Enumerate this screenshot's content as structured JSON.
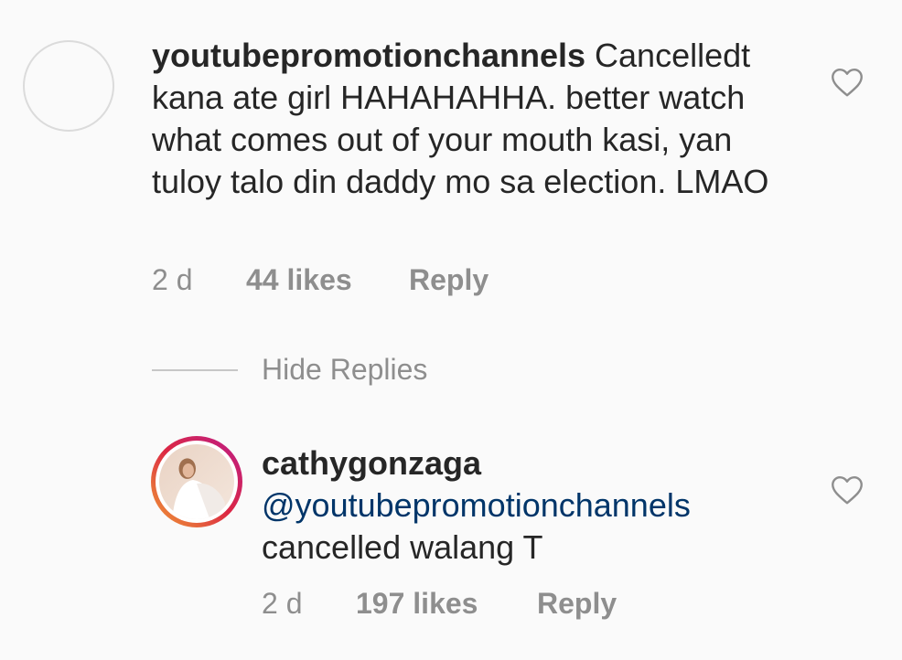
{
  "comments": [
    {
      "username": "youtubepromotionchannels",
      "text": "Cancelledt kana ate girl HAHAHAHHA. better watch what comes out of your mouth kasi, yan tuloy talo din daddy mo sa election. LMAO",
      "time": "2 d",
      "likes": "44 likes",
      "reply_label": "Reply",
      "avatar_icon": "default-avatar",
      "liked": false
    },
    {
      "username": "cathygonzaga",
      "mention": "@youtubepromotionchannels",
      "text": "cancelled walang T",
      "time": "2 d",
      "likes": "197 likes",
      "reply_label": "Reply",
      "avatar_icon": "profile-photo-with-story-ring",
      "liked": false
    }
  ],
  "thread": {
    "hide_replies_label": "Hide Replies"
  },
  "colors": {
    "text": "#262626",
    "secondary": "#8e8e8e",
    "mention": "#003569",
    "background": "#fafafa"
  }
}
